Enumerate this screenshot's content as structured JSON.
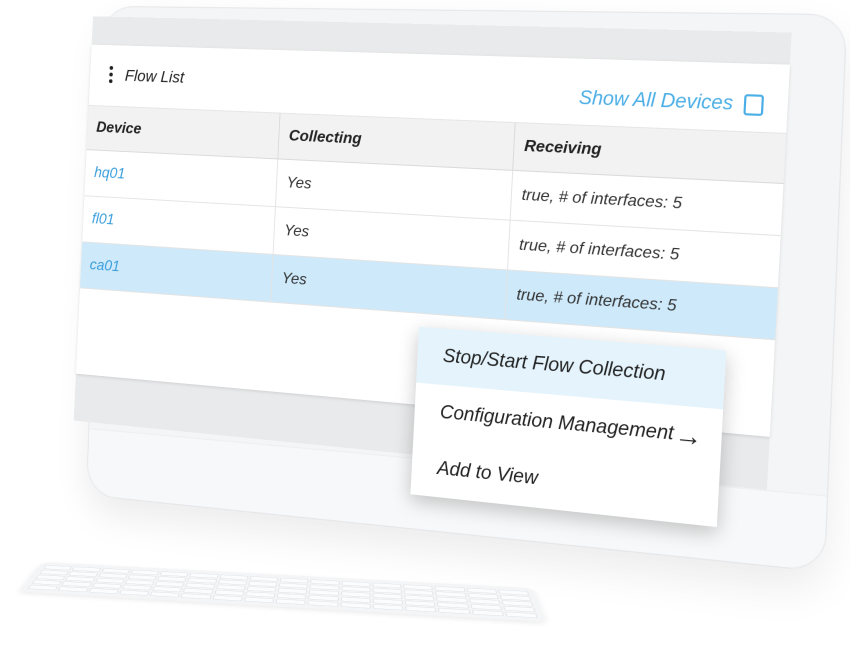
{
  "panel": {
    "title": "Flow List",
    "show_all_label": "Show All Devices",
    "show_all_checked": false
  },
  "table": {
    "headers": [
      "Device",
      "Collecting",
      "Receiving"
    ],
    "rows": [
      {
        "device": "hq01",
        "collecting": "Yes",
        "receiving": "true, # of interfaces: 5",
        "selected": false
      },
      {
        "device": "fl01",
        "collecting": "Yes",
        "receiving": "true, # of interfaces: 5",
        "selected": false
      },
      {
        "device": "ca01",
        "collecting": "Yes",
        "receiving": "true, # of interfaces: 5",
        "selected": true
      }
    ]
  },
  "context_menu": {
    "items": [
      {
        "label": "Stop/Start Flow Collection",
        "highlighted": true,
        "submenu": false
      },
      {
        "label": "Configuration Management",
        "highlighted": false,
        "submenu": true
      },
      {
        "label": "Add to View",
        "highlighted": false,
        "submenu": false
      }
    ]
  },
  "colors": {
    "accent": "#4aaee6",
    "link": "#3a9edc",
    "selected_row": "#cde9fa",
    "menu_highlight": "#e4f3fc"
  },
  "icons": {
    "menu": "kebab-icon",
    "checkbox": "checkbox-icon",
    "submenu": "arrow-right-icon"
  }
}
